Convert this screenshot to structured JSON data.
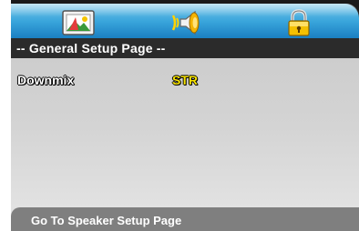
{
  "menu_tabs": [
    {
      "icon": "general-setup-icon"
    },
    {
      "icon": "audio-setup-icon"
    },
    {
      "icon": "lock-icon"
    }
  ],
  "page_title": "-- General Setup Page --",
  "settings": [
    {
      "label": "Downmix",
      "value": "STR"
    }
  ],
  "footer_hint": "Go To Speaker Setup Page",
  "colors": {
    "tray_blue": "#3aa6dc",
    "header_bg": "#2b2b2b",
    "value_yellow": "#f6e200",
    "footer_bg": "#7f7f7f"
  }
}
